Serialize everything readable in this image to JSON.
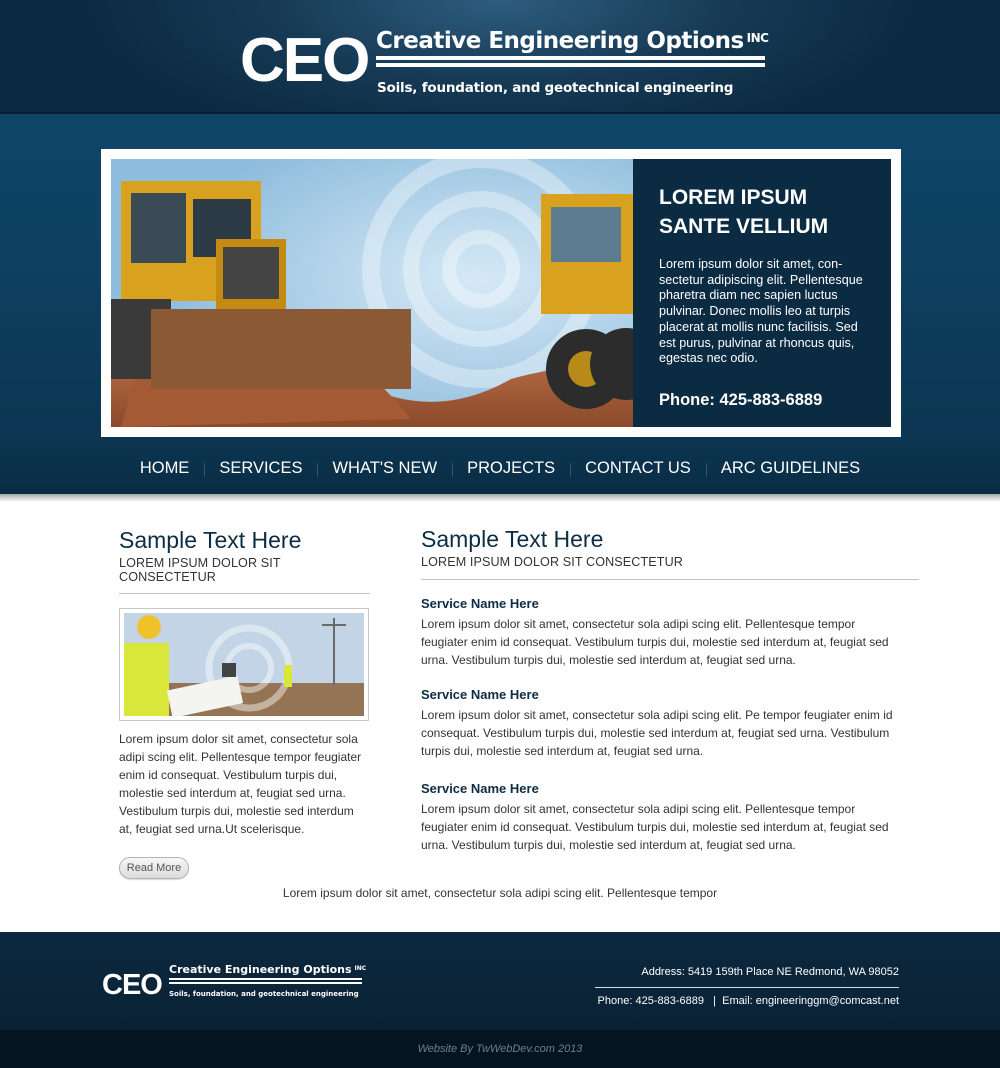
{
  "brand": {
    "mark": "CEO",
    "name": "Creative Engineering Options",
    "suffix": "INC",
    "tagline": "Soils, foundation,  and geotechnical engineering"
  },
  "hero": {
    "title_line1": "LOREM IPSUM",
    "title_line2": "SANTE VELLIUM",
    "text": "Lorem ipsum dolor sit amet, con-sectetur adipiscing elit. Pellentesque pharetra diam nec sapien luctus pulvinar. Donec mollis leo at turpis placerat at mollis nunc facilisis. Sed est purus, pulvinar at rhoncus quis, egestas nec odio.",
    "phone": "Phone: 425-883-6889"
  },
  "nav": {
    "items": [
      "HOME",
      "SERVICES",
      "WHAT'S NEW",
      "PROJECTS",
      "CONTACT US",
      "ARC GUIDELINES"
    ]
  },
  "left": {
    "heading": "Sample Text Here",
    "subheading": "LOREM IPSUM DOLOR SIT CONSECTETUR",
    "text": "Lorem ipsum dolor sit amet, consectetur sola adipi scing elit. Pellentesque tempor feugiater enim id consequat. Vestibulum turpis dui, molestie sed interdum at, feugiat sed urna. Vestibulum turpis dui, molestie sed interdum at, feugiat sed urna.Ut scelerisque.",
    "button": "Read More"
  },
  "right": {
    "heading": "Sample Text Here",
    "subheading": "LOREM IPSUM DOLOR SIT CONSECTETUR",
    "services": [
      {
        "title": "Service Name Here",
        "text": "Lorem ipsum dolor sit amet, consectetur sola adipi scing elit. Pellentesque tempor feugiater enim id consequat. Vestibulum turpis dui, molestie sed interdum at, feugiat sed urna. Vestibulum turpis dui, molestie sed interdum at, feugiat sed urna."
      },
      {
        "title": "Service Name Here",
        "text": "Lorem ipsum dolor sit amet, consectetur sola adipi scing elit. Pe tempor feugiater enim id consequat. Vestibulum turpis dui, molestie sed interdum at, feugiat sed urna. Vestibulum turpis dui, molestie sed interdum at, feugiat sed urna."
      },
      {
        "title": "Service Name Here",
        "text": "Lorem ipsum dolor sit amet, consectetur sola adipi scing elit. Pellentesque tempor feugiater enim id consequat. Vestibulum turpis dui, molestie sed interdum at, feugiat sed urna. Vestibulum turpis dui, molestie sed interdum at, feugiat sed urna."
      }
    ]
  },
  "bottom_text": "Lorem ipsum dolor sit amet, consectetur sola adipi scing elit. Pellentesque tempor",
  "footer": {
    "address": "Address: 5419 159th Place NE Redmond, WA 98052",
    "phone": "Phone: 425-883-6889",
    "separator": "|",
    "email": "Email: engineeringgm@comcast.net",
    "credit": "Website By TwWebDev.com 2013"
  },
  "colors": {
    "header_bg": "#163a55",
    "band_bg": "#0f4568",
    "panel_bg": "#0b2b43",
    "heading": "#0d2d45",
    "footer_bg": "#0c283e",
    "credit_bg": "#041420"
  },
  "images": {
    "hero": "construction bulldozer and grader with spiral watermark",
    "thumb": "surveyor in hard hat holding blueprints in field"
  }
}
